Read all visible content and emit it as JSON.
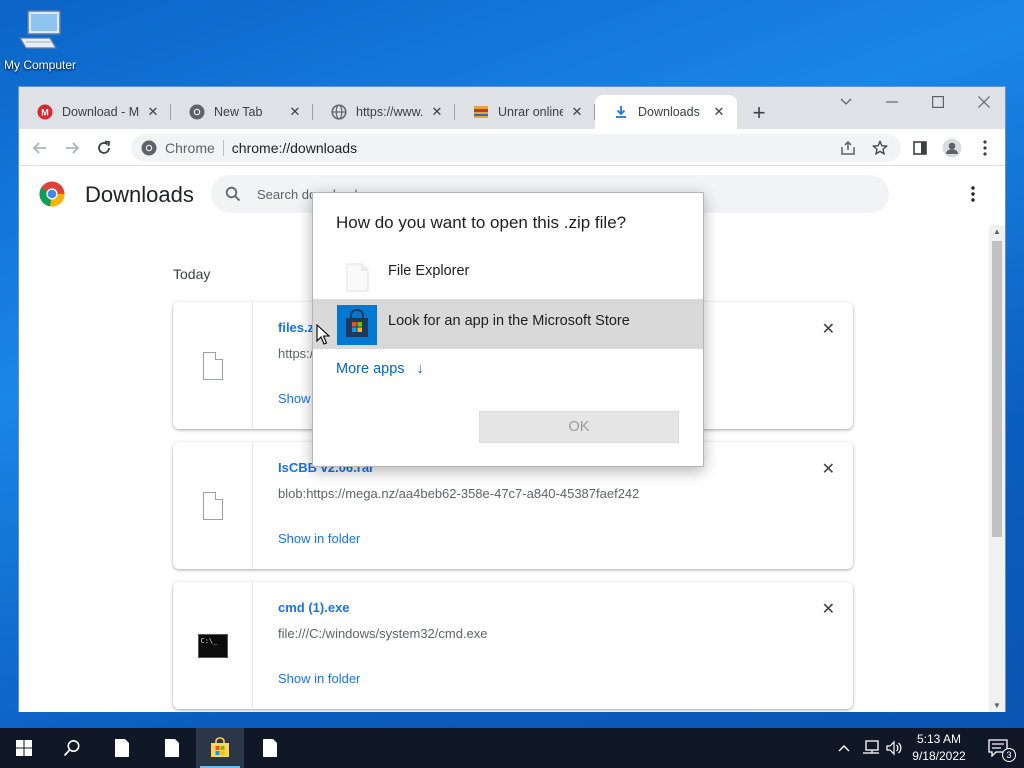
{
  "desktop": {
    "icon_label": "My Computer"
  },
  "browser": {
    "tabs": [
      {
        "title": "Download - M",
        "favicon": "mega-icon"
      },
      {
        "title": "New Tab",
        "favicon": "chrome-icon"
      },
      {
        "title": "https://www.w",
        "favicon": "globe-icon"
      },
      {
        "title": "Unrar online: C",
        "favicon": "unrar-icon"
      },
      {
        "title": "Downloads",
        "favicon": "download-icon"
      }
    ],
    "omnibox": {
      "chip": "Chrome",
      "url": "chrome://downloads"
    }
  },
  "downloads": {
    "title": "Downloads",
    "search_placeholder": "Search downloads",
    "section": "Today",
    "items": [
      {
        "name": "files.z",
        "url": "https:/",
        "action": "Show"
      },
      {
        "name": "IsCBB v2.06.rar",
        "url": "blob:https://mega.nz/aa4beb62-358e-47c7-a840-45387faef242",
        "action": "Show in folder"
      },
      {
        "name": "cmd (1).exe",
        "url": "file:///C:/windows/system32/cmd.exe",
        "action": "Show in folder",
        "icon_text": "C:\\_"
      }
    ]
  },
  "dialog": {
    "title": "How do you want to open this .zip file?",
    "options": [
      {
        "label": "File Explorer"
      },
      {
        "label": "Look for an app in the Microsoft Store"
      }
    ],
    "more": "More apps",
    "more_arrow": "↓",
    "ok": "OK"
  },
  "taskbar": {
    "time": "5:13 AM",
    "date": "9/18/2022",
    "notification_count": "3",
    "tray_chevron": "^"
  }
}
